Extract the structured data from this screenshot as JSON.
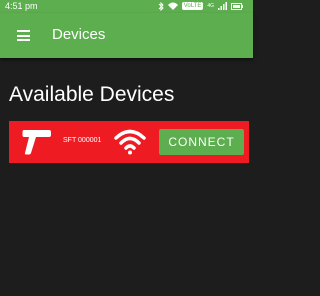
{
  "status_bar": {
    "time": "4:51 pm",
    "bluetooth_icon": "bluetooth-icon",
    "wifi_icon": "wifi-icon",
    "volte_label": "VoLTE",
    "signal_label": "4G",
    "battery_icon": "battery-icon"
  },
  "app_bar": {
    "menu_icon": "menu-icon",
    "title": "Devices"
  },
  "main": {
    "section_title": "Available Devices",
    "devices": [
      {
        "icon": "screw-gun-icon",
        "name": "SFT 000001",
        "signal_icon": "wifi-signal-icon",
        "connect_label": "CONNECT"
      }
    ]
  },
  "colors": {
    "accent_green": "#5cae4e",
    "card_red": "#ee1c22",
    "background": "#1d1d1d",
    "text": "#ffffff"
  }
}
